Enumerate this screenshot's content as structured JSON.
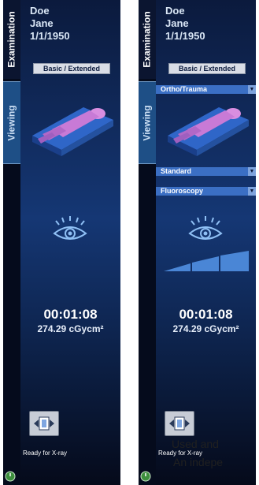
{
  "left_panel": {
    "tab_examination": "Examination",
    "tab_viewing": "Viewing",
    "patient_last_name": "Doe",
    "patient_first_name": "Jane",
    "patient_dob": "1/1/1950",
    "basic_extended_button": "Basic / Extended",
    "exposure_time": "00:01:08",
    "dose": "274.29 cGycm²",
    "status": "Ready for X-ray"
  },
  "right_panel": {
    "tab_examination": "Examination",
    "tab_viewing": "Viewing",
    "patient_last_name": "Doe",
    "patient_first_name": "Jane",
    "patient_dob": "1/1/1950",
    "basic_extended_button": "Basic / Extended",
    "protocol_dropdown": "Ortho/Trauma",
    "program_dropdown": "Standard",
    "mode_dropdown": "Fluoroscopy",
    "exposure_time": "00:01:08",
    "dose": "274.29 cGycm²",
    "status": "Ready for X-ray"
  },
  "overlay_text": {
    "line1": "Used and",
    "line2": "An indepe"
  },
  "icons": {
    "patient": "patient-on-table-icon",
    "eye": "eye-icon",
    "dose_level": "dose-level-bars-icon",
    "xray_button": "xray-acquire-icon",
    "power": "power-icon",
    "dropdown_arrow": "chevron-down-icon"
  },
  "colors": {
    "panel_dark": "#0b1530",
    "tab_viewing": "#1e4f86",
    "dropdown": "#3b6fc4",
    "dose_bars": "#4a86d6",
    "text_light": "#d9e6f5"
  }
}
